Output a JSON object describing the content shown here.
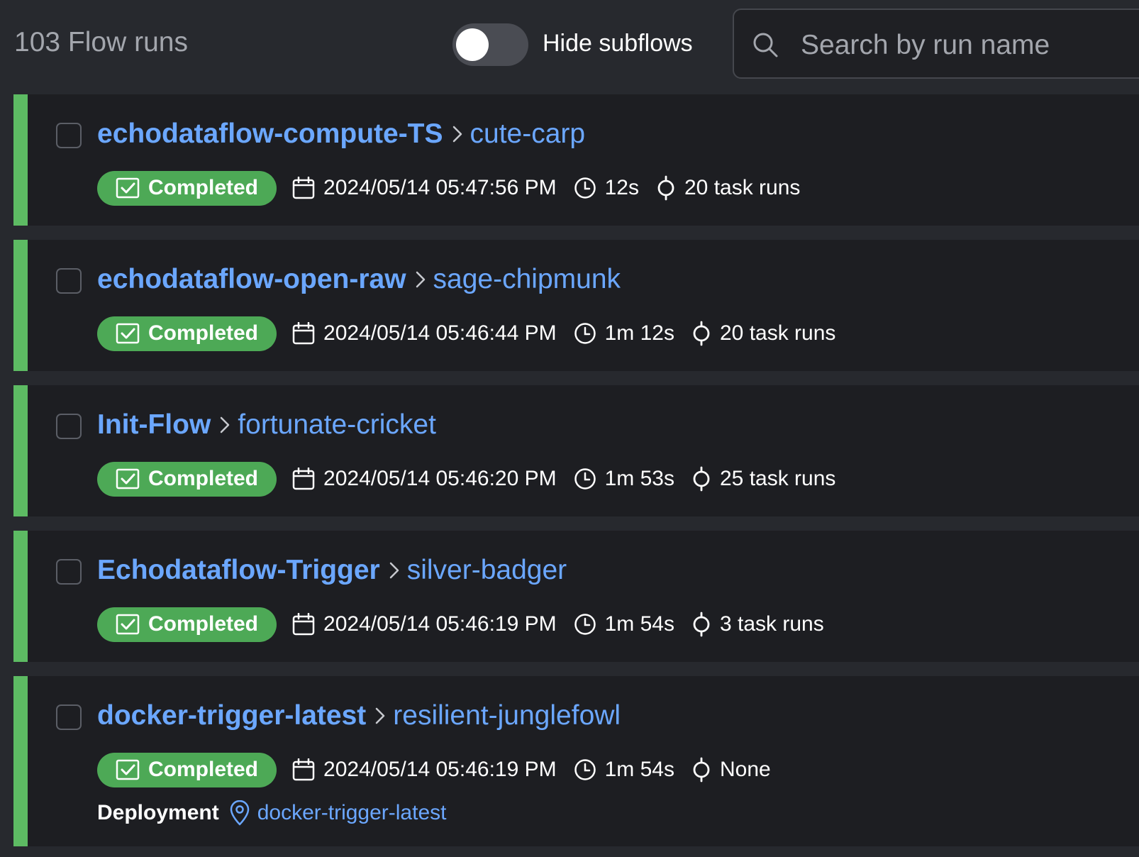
{
  "header": {
    "flow_runs_count": "103 Flow runs",
    "hide_subflows_label": "Hide subflows",
    "hide_subflows_on": false,
    "search_placeholder": "Search by run name"
  },
  "colors": {
    "completed": "#4da956",
    "row_accent": "#5dbb63",
    "link": "#6ba7ff"
  },
  "icons": {
    "badge": "check-square-icon",
    "start_time": "calendar-icon",
    "duration": "clock-icon",
    "task_runs": "task-runs-icon",
    "deployment": "map-pin-icon",
    "separator": "chevron-right-icon"
  },
  "runs": [
    {
      "flow": "echodataflow-compute-TS",
      "run": "cute-carp",
      "state": "Completed",
      "start": "2024/05/14 05:47:56 PM",
      "duration": "12s",
      "task_runs": "20 task runs"
    },
    {
      "flow": "echodataflow-open-raw",
      "run": "sage-chipmunk",
      "state": "Completed",
      "start": "2024/05/14 05:46:44 PM",
      "duration": "1m 12s",
      "task_runs": "20 task runs"
    },
    {
      "flow": "Init-Flow",
      "run": "fortunate-cricket",
      "state": "Completed",
      "start": "2024/05/14 05:46:20 PM",
      "duration": "1m 53s",
      "task_runs": "25 task runs"
    },
    {
      "flow": "Echodataflow-Trigger",
      "run": "silver-badger",
      "state": "Completed",
      "start": "2024/05/14 05:46:19 PM",
      "duration": "1m 54s",
      "task_runs": "3 task runs"
    },
    {
      "flow": "docker-trigger-latest",
      "run": "resilient-junglefowl",
      "state": "Completed",
      "start": "2024/05/14 05:46:19 PM",
      "duration": "1m 54s",
      "task_runs": "None",
      "deployment_label": "Deployment",
      "deployment": "docker-trigger-latest"
    }
  ]
}
